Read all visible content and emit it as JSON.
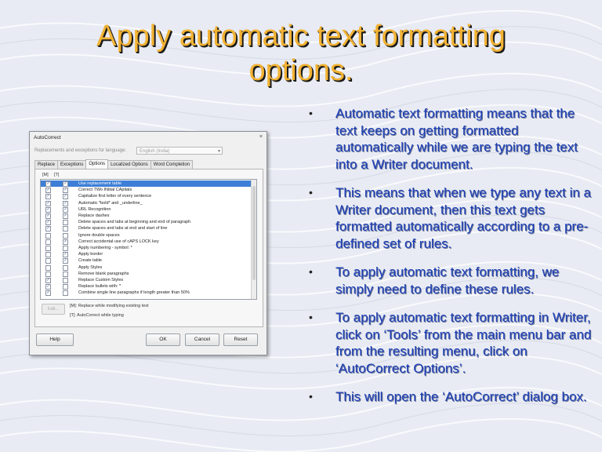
{
  "slide": {
    "title": "Apply automatic text formatting\noptions.",
    "bullets": [
      "Automatic text formatting means that the text keeps on getting formatted automatically while we are typing the text into a Writer document.",
      "This means that when we type any text in a Writer document, then this text gets formatted automatically according to a pre-defined set of rules.",
      "To apply automatic text formatting, we simply need to define these rules.",
      "To apply automatic text formatting in Writer, click on ‘Tools’ from the main menu bar and from the resulting menu, click on ‘AutoCorrect Options’.",
      "This will open the ‘AutoCorrect’ dialog box."
    ],
    "bullet_glyph": "•",
    "colors": {
      "title": "#f2b233",
      "bullet_text": "#1c3fb8"
    }
  },
  "dialog": {
    "title": "AutoCorrect",
    "close_glyph": "×",
    "lang_label": "Replacements and exceptions for language:",
    "lang_value": "English (India)",
    "tabs": [
      "Replace",
      "Exceptions",
      "Options",
      "Localized Options",
      "Word Completion"
    ],
    "active_tab": 2,
    "col_m": "[M]",
    "col_t": "[T]",
    "check_glyph": "✓",
    "options": [
      {
        "label": "Use replacement table",
        "m": true,
        "t": true,
        "selected": true
      },
      {
        "label": "Correct TWo INitial CApitals",
        "m": true,
        "t": true
      },
      {
        "label": "Capitalize first letter of every sentence",
        "m": true,
        "t": true
      },
      {
        "label": "Automatic *bold* and _underline_",
        "m": true,
        "t": true
      },
      {
        "label": "URL Recognition",
        "m": true,
        "t": true
      },
      {
        "label": "Replace dashes",
        "m": true,
        "t": true
      },
      {
        "label": "Delete spaces and tabs at beginning and end of paragraph",
        "m": true,
        "t": false
      },
      {
        "label": "Delete spaces and tabs at end and start of line",
        "m": true,
        "t": false
      },
      {
        "label": "Ignore double spaces",
        "m": false,
        "t": false
      },
      {
        "label": "Correct accidental use of cAPS LOCK key",
        "m": false,
        "t": true
      },
      {
        "label": "Apply numbering - symbol: *",
        "m": false,
        "t": false
      },
      {
        "label": "Apply border",
        "m": false,
        "t": true
      },
      {
        "label": "Create table",
        "m": false,
        "t": true
      },
      {
        "label": "Apply Styles",
        "m": false,
        "t": false
      },
      {
        "label": "Remove blank paragraphs",
        "m": false,
        "t": false
      },
      {
        "label": "Replace Custom Styles",
        "m": true,
        "t": false
      },
      {
        "label": "Replace bullets with: *",
        "m": true,
        "t": false
      },
      {
        "label": "Combine single line paragraphs if length greater than 50%",
        "m": true,
        "t": false
      }
    ],
    "edit_label": "Edit...",
    "legend_m": "[M]: Replace while modifying existing text",
    "legend_t": "[T]: AutoCorrect while typing",
    "buttons": {
      "help": "Help",
      "ok": "OK",
      "cancel": "Cancel",
      "reset": "Reset"
    }
  }
}
